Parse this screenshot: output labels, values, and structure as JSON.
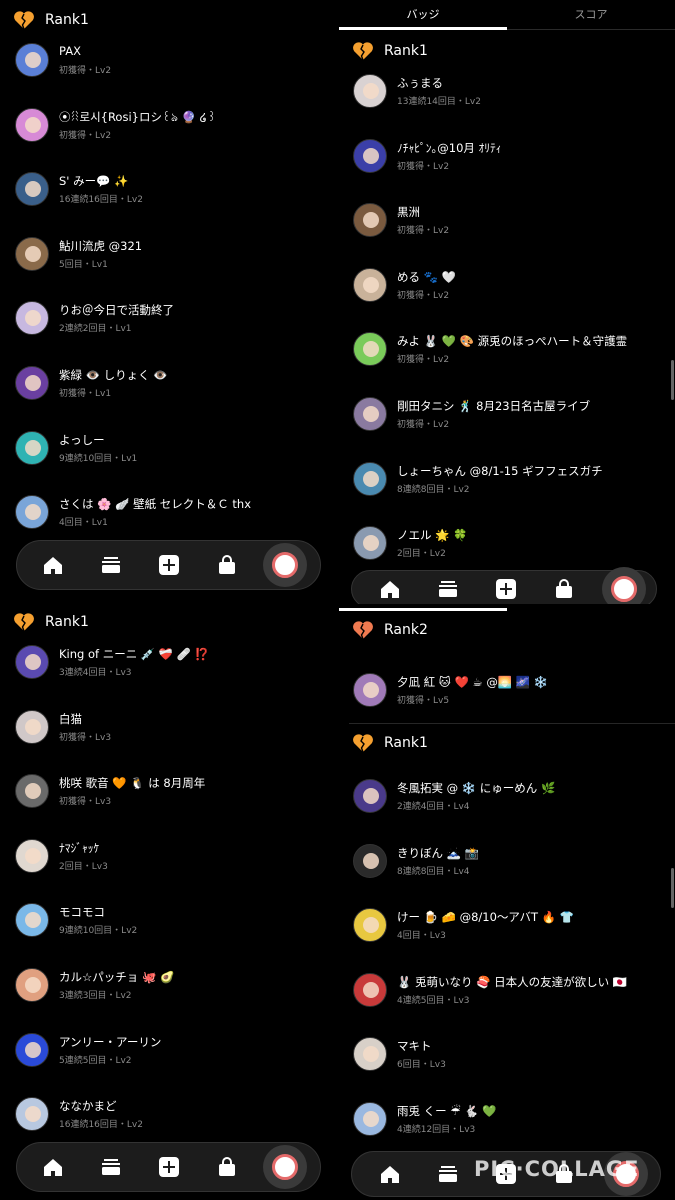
{
  "colors": {
    "background": "#000000",
    "accent_orange": "#f5a030",
    "meta_gray": "#8a8a8a",
    "nav_bg": "#1c1c1c"
  },
  "icons": {
    "rank": "broken-heart-icon",
    "nav": [
      "home-icon",
      "list-icon",
      "plus-icon",
      "bag-icon",
      "profile-avatar"
    ]
  },
  "panel_top_left": {
    "rank_label": "Rank1",
    "entries": [
      {
        "name": "PAX",
        "meta": "初獲得・Lv2",
        "color": "#5a7fd6"
      },
      {
        "name": "⦿ꋧ로시{Rosi}ロシ꒰ঌ 🔮 ໒꒱",
        "meta": "初獲得・Lv2",
        "color": "#d78ad6"
      },
      {
        "name": "S' みー💬 ✨",
        "meta": "16連続16回目・Lv2",
        "color": "#3a5f8a"
      },
      {
        "name": "鮎川流虎 @321",
        "meta": "5回目・Lv1",
        "color": "#8a6a4a"
      },
      {
        "name": "りお＠今日で活動終了",
        "meta": "2連続2回目・Lv1",
        "color": "#c7b8e0"
      },
      {
        "name": "紫緑 👁️ しりょく 👁️",
        "meta": "初獲得・Lv1",
        "color": "#6a3fa0"
      },
      {
        "name": "よっしー",
        "meta": "9連続10回目・Lv1",
        "color": "#2fb3b3"
      },
      {
        "name": "さくは 🌸 🪽 壁紙 セレクト＆Ｃ thx",
        "meta": "4回目・Lv1",
        "color": "#7aa5d8"
      }
    ]
  },
  "panel_top_right": {
    "tabs": [
      "バッジ",
      "スコア"
    ],
    "rank_label": "Rank1",
    "entries": [
      {
        "name": "ふぅまる",
        "meta": "13連続14回目・Lv2",
        "color": "#d9d2d2"
      },
      {
        "name": "ﾉﾁｬﾋﾟﾝ｡@10月 ｵﾘﾃｨ",
        "meta": "初獲得・Lv2",
        "color": "#3b3fa8"
      },
      {
        "name": "黒洲",
        "meta": "初獲得・Lv2",
        "color": "#7a5a3f"
      },
      {
        "name": "める 🐾 🤍",
        "meta": "初獲得・Lv2",
        "color": "#c9b29a"
      },
      {
        "name": "みよ 🐰 💚 🎨 源兎のほっぺハート＆守護霊",
        "meta": "初獲得・Lv2",
        "color": "#7acb5a"
      },
      {
        "name": "剛田タニシ 🕺 8月23日名古屋ライブ",
        "meta": "初獲得・Lv2",
        "color": "#8a7aa0"
      },
      {
        "name": "しょーちゃん @8/1-15 ギフフェスガチ",
        "meta": "8連続8回目・Lv2",
        "color": "#4a8ab0"
      },
      {
        "name": "ノエル 🌟 🍀",
        "meta": "2回目・Lv2",
        "color": "#8a9ab0"
      }
    ]
  },
  "panel_bottom_left": {
    "rank_label": "Rank1",
    "entries": [
      {
        "name": "King of ニーニ 💉 ❤️‍🩹 🩹 ⁉️",
        "meta": "3連続4回目・Lv3",
        "color": "#5a4ab0"
      },
      {
        "name": "白猫",
        "meta": "初獲得・Lv3",
        "color": "#d0c8c8"
      },
      {
        "name": "桃咲 歌音 🧡 🐧 は 8月周年",
        "meta": "初獲得・Lv3",
        "color": "#6a6a6a"
      },
      {
        "name": "ﾅﾏｼﾞｬｯｹ",
        "meta": "2回目・Lv3",
        "color": "#e0d8d0"
      },
      {
        "name": "モコモコ",
        "meta": "9連続10回目・Lv2",
        "color": "#7ab8e8"
      },
      {
        "name": "カル☆パッチョ 🐙 🥑",
        "meta": "3連続3回目・Lv2",
        "color": "#e0a080"
      },
      {
        "name": "アンリー・アーリン",
        "meta": "5連続5回目・Lv2",
        "color": "#2a4ad8"
      },
      {
        "name": "ななかまど",
        "meta": "16連続16回目・Lv2",
        "color": "#b8c8e0"
      }
    ]
  },
  "panel_bottom_right": {
    "rank2_label": "Rank2",
    "rank2_entries": [
      {
        "name": "夕凪 紅 🐱 ❤️ ☕ @🌅 🌌 ❄️",
        "meta": "初獲得・Lv5",
        "color": "#a07ab8"
      }
    ],
    "rank1_label": "Rank1",
    "rank1_entries": [
      {
        "name": "冬風拓実 @ ❄️ にゅーめん 🌿",
        "meta": "2連続4回目・Lv4",
        "color": "#4a3a8a"
      },
      {
        "name": "きりぼん 🗻 📸",
        "meta": "8連続8回目・Lv4",
        "color": "#2a2a2a"
      },
      {
        "name": "けー 🍺 🧀 @8/10〜アバT 🔥 👕",
        "meta": "4回目・Lv3",
        "color": "#e8c840"
      },
      {
        "name": "🐰 兎萌いなり 🍣 日本人の友達が欲しい 🇯🇵",
        "meta": "4連続5回目・Lv3",
        "color": "#c83a3a"
      },
      {
        "name": "マキト",
        "meta": "6回目・Lv3",
        "color": "#d8d0c8"
      },
      {
        "name": "雨兎 くー ☔ 🐇 💚",
        "meta": "4連続12回目・Lv3",
        "color": "#9ab8e0"
      }
    ]
  },
  "watermark": "PIC·COLLAGE"
}
